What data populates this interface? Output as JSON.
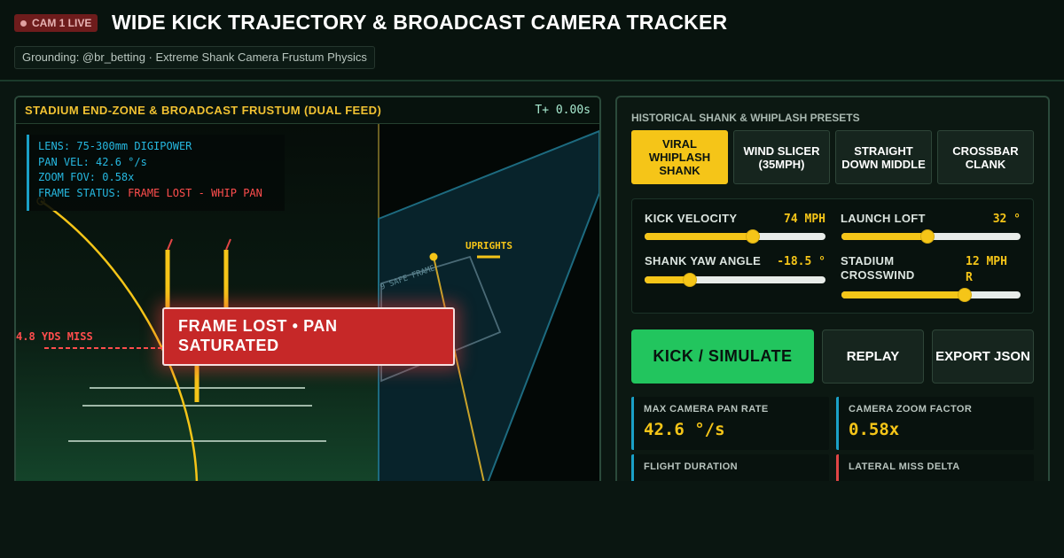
{
  "header": {
    "live_badge": "CAM 1 LIVE",
    "title": "WIDE KICK TRAJECTORY & BROADCAST CAMERA TRACKER",
    "grounding": "Grounding: @br_betting · Extreme Shank Camera Frustum Physics"
  },
  "stage": {
    "title": "STADIUM END-ZONE & BROADCAST FRUSTUM (DUAL FEED)",
    "time": "T+ 0.00s",
    "hud": {
      "lens": "LENS: 75-300mm DIGIPOWER",
      "pan": "PAN VEL: 42.6 °/s",
      "zoom": "ZOOM FOV: 0.58x",
      "frame_prefix": "FRAME STATUS: ",
      "frame_status": "FRAME LOST - WHIP PAN"
    },
    "alert": "FRAME LOST • PAN SATURATED",
    "miss_label": "4.8 YDS MISS",
    "uprights_label": "UPRIGHTS",
    "safe_frame_label": "9 SAFE FRAME",
    "colors": {
      "accent": "#f5c518",
      "alert": "#c62828",
      "hud": "#26b8e0",
      "miss": "#ff4d4d"
    }
  },
  "panel": {
    "presets_label": "HISTORICAL SHANK & WHIPLASH PRESETS",
    "presets": [
      {
        "label": "VIRAL WHIPLASH SHANK",
        "active": true
      },
      {
        "label": "WIND SLICER (35MPH)",
        "active": false
      },
      {
        "label": "STRAIGHT DOWN MIDDLE",
        "active": false
      },
      {
        "label": "CROSSBAR CLANK",
        "active": false
      }
    ],
    "sliders": {
      "velocity": {
        "label": "KICK VELOCITY",
        "value": "74 MPH",
        "level": 0.6
      },
      "loft": {
        "label": "LAUNCH LOFT",
        "value": "32 °",
        "level": 0.48
      },
      "yaw": {
        "label": "SHANK YAW ANGLE",
        "value": "-18.5 °",
        "level": 0.25
      },
      "wind": {
        "label": "STADIUM CROSSWIND",
        "value": "12 MPH R",
        "level": 0.69
      }
    },
    "buttons": {
      "kick": "KICK / SIMULATE",
      "replay": "REPLAY",
      "export": "EXPORT JSON"
    },
    "metrics": {
      "pan_rate": {
        "label": "MAX CAMERA PAN RATE",
        "value": "42.6 °/s"
      },
      "zoom": {
        "label": "CAMERA ZOOM FACTOR",
        "value": "0.58x"
      },
      "flight": {
        "label": "FLIGHT DURATION",
        "value": ""
      },
      "miss": {
        "label": "LATERAL MISS DELTA",
        "value": ""
      }
    }
  }
}
